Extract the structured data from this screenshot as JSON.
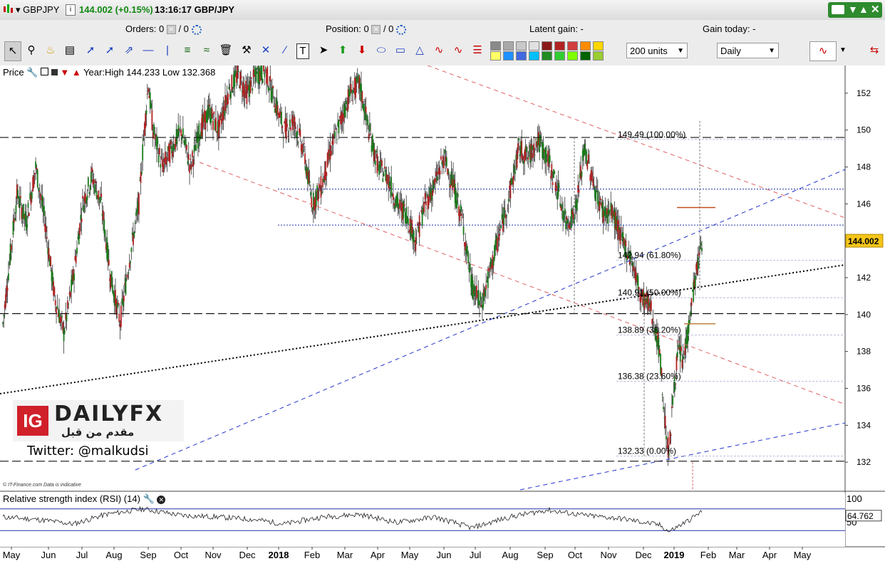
{
  "header": {
    "instrument": "GBPJPY",
    "price": "144.002 (+0.15%)",
    "time_symbol": "13:16:17 GBP/JPY",
    "window_controls": [
      "keyboard-icon",
      "minimize-icon",
      "restore-icon",
      "close-icon"
    ]
  },
  "status": {
    "orders_label": "Orders: 0",
    "orders_sep": "/ 0",
    "position_label": "Position: 0",
    "position_sep": "/ 0",
    "latent_gain": "Latent gain: -",
    "gain_today": "Gain today: -"
  },
  "toolbar": {
    "units": "200 units",
    "timeframe": "Daily",
    "drawing_colors": [
      "#8a8a8a",
      "#a9a9a9",
      "#c8c8c8",
      "#e0e0e0",
      "#8b1a1a",
      "#b22222",
      "#d23d3d",
      "#ff8c00",
      "#ffd700",
      "#ffff66",
      "#1e90ff",
      "#4169e1",
      "#00bfff",
      "#228b22",
      "#32cd32",
      "#7fff00",
      "#006400",
      "#9acd32"
    ]
  },
  "price_panel": {
    "label": "Price",
    "info": "Year:High 144.233 Low 132.368",
    "current_price": "144.002"
  },
  "rsi_panel": {
    "label": "Relative strength index (RSI) (14)",
    "current_value": "64.762",
    "axis_top": "100",
    "axis_mid": "50"
  },
  "brand": {
    "logo_ig": "IG",
    "logo_text": "DAILYFX",
    "tagline": "مقدم من قبل",
    "twitter": "Twitter: @malkudsi",
    "source": "© IT-Finance.com  Data is indicative"
  },
  "chart_data": {
    "type": "candlestick",
    "instrument": "GBPJPY",
    "timeframe": "Daily",
    "ylim": [
      130.5,
      153.5
    ],
    "y_ticks": [
      132,
      134,
      136,
      138,
      140,
      142,
      144,
      146,
      148,
      150,
      152
    ],
    "x_ticks": [
      "May",
      "Jun",
      "Jul",
      "Aug",
      "Sep",
      "Oct",
      "Nov",
      "Dec",
      "2018",
      "Feb",
      "Mar",
      "Apr",
      "May",
      "Jun",
      "Jul",
      "Aug",
      "Sep",
      "Oct",
      "Nov",
      "Dec",
      "2019",
      "Feb",
      "Mar",
      "Apr",
      "May"
    ],
    "x_ticks_bold": [
      "2018",
      "2019"
    ],
    "price_path": [
      [
        0,
        139.5
      ],
      [
        3,
        146.5
      ],
      [
        5,
        145
      ],
      [
        7,
        148
      ],
      [
        9,
        145
      ],
      [
        11,
        141
      ],
      [
        13,
        139
      ],
      [
        15,
        142
      ],
      [
        17,
        146
      ],
      [
        19,
        147.5
      ],
      [
        21,
        146
      ],
      [
        23,
        142
      ],
      [
        25,
        139.6
      ],
      [
        27,
        143
      ],
      [
        29,
        146
      ],
      [
        30,
        149.5
      ],
      [
        31,
        152.5
      ],
      [
        32,
        150
      ],
      [
        34,
        148
      ],
      [
        36,
        149
      ],
      [
        38,
        150
      ],
      [
        40,
        148
      ],
      [
        42,
        150
      ],
      [
        44,
        151
      ],
      [
        46,
        150
      ],
      [
        48,
        152
      ],
      [
        50,
        153
      ],
      [
        52,
        152
      ],
      [
        54,
        153
      ],
      [
        56,
        153.2
      ],
      [
        58,
        151.5
      ],
      [
        60,
        150
      ],
      [
        62,
        150.5
      ],
      [
        64,
        149
      ],
      [
        66,
        146
      ],
      [
        68,
        147
      ],
      [
        70,
        149
      ],
      [
        72,
        150.5
      ],
      [
        74,
        152
      ],
      [
        76,
        152.5
      ],
      [
        78,
        150
      ],
      [
        80,
        148
      ],
      [
        82,
        147.5
      ],
      [
        84,
        146
      ],
      [
        86,
        145.5
      ],
      [
        88,
        144
      ],
      [
        90,
        146
      ],
      [
        92,
        147
      ],
      [
        94,
        148.5
      ],
      [
        96,
        147
      ],
      [
        98,
        145
      ],
      [
        100,
        141.5
      ],
      [
        102,
        140.5
      ],
      [
        104,
        142.5
      ],
      [
        106,
        144.5
      ],
      [
        108,
        146.5
      ],
      [
        110,
        149
      ],
      [
        112,
        148.5
      ],
      [
        114,
        149.5
      ],
      [
        116,
        148.5
      ],
      [
        118,
        147
      ],
      [
        120,
        145
      ],
      [
        122,
        145.5
      ],
      [
        124,
        149
      ],
      [
        126,
        147
      ],
      [
        128,
        145.5
      ],
      [
        130,
        145.5
      ],
      [
        132,
        144
      ],
      [
        134,
        143
      ],
      [
        136,
        141
      ],
      [
        138,
        140.5
      ],
      [
        140,
        138
      ],
      [
        141,
        134.5
      ],
      [
        142,
        132.4
      ],
      [
        143,
        136
      ],
      [
        144,
        138
      ],
      [
        145,
        137.5
      ],
      [
        146,
        139
      ],
      [
        147,
        141
      ],
      [
        148,
        142.5
      ],
      [
        149,
        144
      ]
    ],
    "horizontal_levels": [
      {
        "value": 149.6,
        "style": "black-dash"
      },
      {
        "value": 140.05,
        "style": "black-dash"
      },
      {
        "value": 132.05,
        "style": "black-dash"
      },
      {
        "value": 146.8,
        "style": "blue-dot"
      },
      {
        "value": 144.85,
        "style": "blue-dot"
      }
    ],
    "fibonacci": [
      {
        "label": "149.49 (100.00%)",
        "value": 149.49
      },
      {
        "label": "142.94 (61.80%)",
        "value": 142.94
      },
      {
        "label": "140.91 (50.00%)",
        "value": 140.91
      },
      {
        "label": "138.89 (38.20%)",
        "value": 138.89
      },
      {
        "label": "136.38 (23.60%)",
        "value": 136.38
      },
      {
        "label": "132.33 (0.00%)",
        "value": 132.33
      }
    ],
    "marker_levels": [
      145.8,
      139.5
    ],
    "rsi": {
      "upper_level": 70,
      "lower_level": 30,
      "last": 64.762,
      "path": [
        [
          0,
          55
        ],
        [
          8,
          50
        ],
        [
          15,
          42
        ],
        [
          22,
          60
        ],
        [
          30,
          70
        ],
        [
          38,
          58
        ],
        [
          46,
          55
        ],
        [
          54,
          50
        ],
        [
          60,
          42
        ],
        [
          68,
          55
        ],
        [
          76,
          60
        ],
        [
          84,
          45
        ],
        [
          92,
          55
        ],
        [
          100,
          35
        ],
        [
          108,
          55
        ],
        [
          116,
          68
        ],
        [
          124,
          58
        ],
        [
          132,
          52
        ],
        [
          140,
          40
        ],
        [
          142,
          28
        ],
        [
          146,
          48
        ],
        [
          149,
          65
        ]
      ]
    }
  }
}
